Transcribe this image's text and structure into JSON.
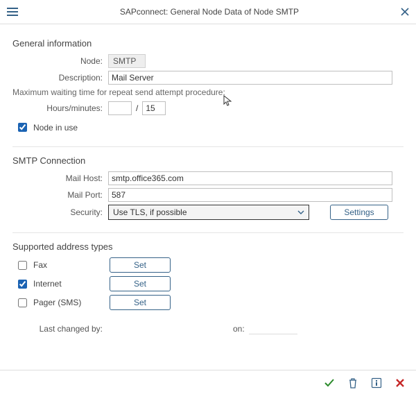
{
  "titlebar": {
    "title": "SAPconnect: General Node Data of Node SMTP"
  },
  "general": {
    "heading": "General information",
    "node_label": "Node:",
    "node_value": "SMTP",
    "desc_label": "Description:",
    "desc_value": "Mail Server",
    "wait_text": "Maximum waiting time for repeat send attempt procedure:",
    "hm_label": "Hours/minutes:",
    "hours_value": "",
    "slash": "/",
    "minutes_value": "15",
    "in_use_label": "Node in use"
  },
  "smtp": {
    "heading": "SMTP Connection",
    "host_label": "Mail Host:",
    "host_value": "smtp.office365.com",
    "port_label": "Mail Port:",
    "port_value": "587",
    "security_label": "Security:",
    "security_value": "Use TLS, if possible",
    "settings_btn": "Settings"
  },
  "addr": {
    "heading": "Supported address types",
    "fax_label": "Fax",
    "internet_label": "Internet",
    "pager_label": "Pager (SMS)",
    "set_btn": "Set"
  },
  "footer": {
    "changed_by_label": "Last changed by:",
    "changed_by_value": "",
    "on_label": "on:",
    "on_value": ""
  }
}
